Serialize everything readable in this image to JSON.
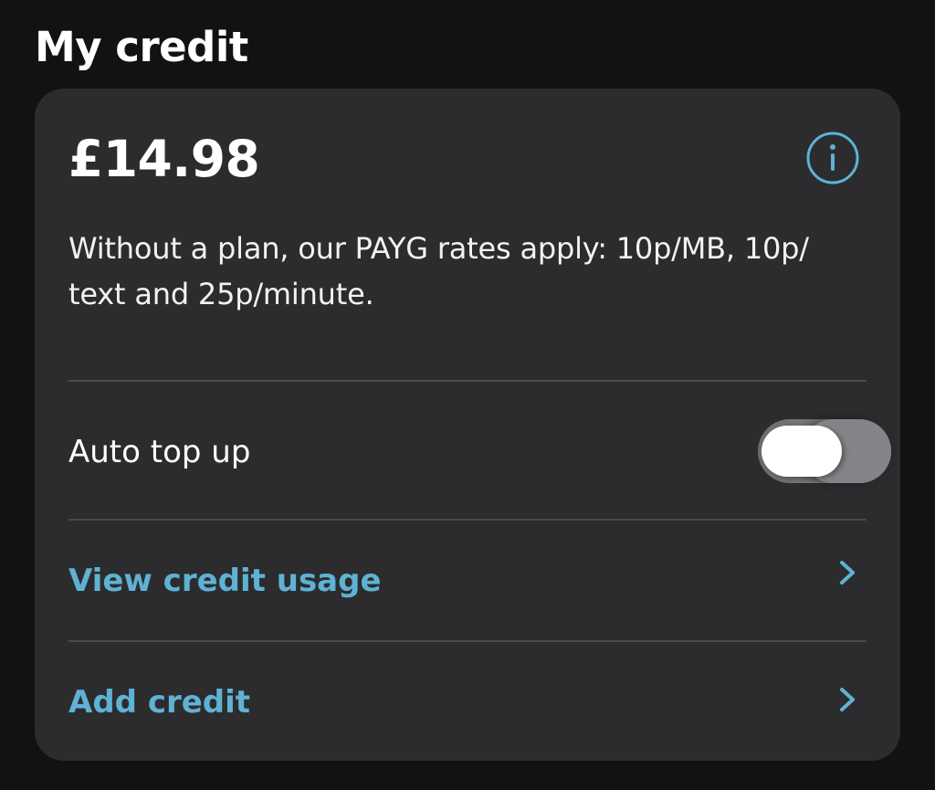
{
  "header": {
    "title": "My credit"
  },
  "credit": {
    "balance": "£14.98",
    "description": "Without a plan, our PAYG rates apply: 10p/MB, 10p/ text and 25p/minute.",
    "info_icon": "info-circle-icon"
  },
  "auto_top_up": {
    "label": "Auto top up",
    "enabled": false
  },
  "links": {
    "view_usage": "View credit usage",
    "add_credit": "Add credit",
    "chevron_icon": "chevron-right-icon"
  },
  "colors": {
    "background": "#121212",
    "card": "#2c2c2e",
    "accent": "#5fb2d4",
    "divider": "#4a4a4c"
  }
}
